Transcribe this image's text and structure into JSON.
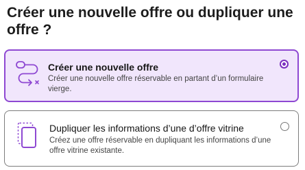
{
  "page": {
    "title": "Créer une nouvelle offre ou dupliquer une offre ?"
  },
  "options": [
    {
      "title": "Créer une nouvelle offre",
      "description": "Créer une nouvelle offre réservable en partant d’un formulaire vierge.",
      "icon": "route-path-icon",
      "selected": true
    },
    {
      "title": "Dupliquer les informations d’une d’offre vitrine",
      "description": "Créez une offre réservable en dupliquant les informations d’une offre vitrine existante.",
      "icon": "duplicate-document-icon",
      "selected": false
    }
  ],
  "colors": {
    "accent": "#8e48d2",
    "selected_background": "#f1e6fc",
    "border": "#7c7c7c"
  }
}
